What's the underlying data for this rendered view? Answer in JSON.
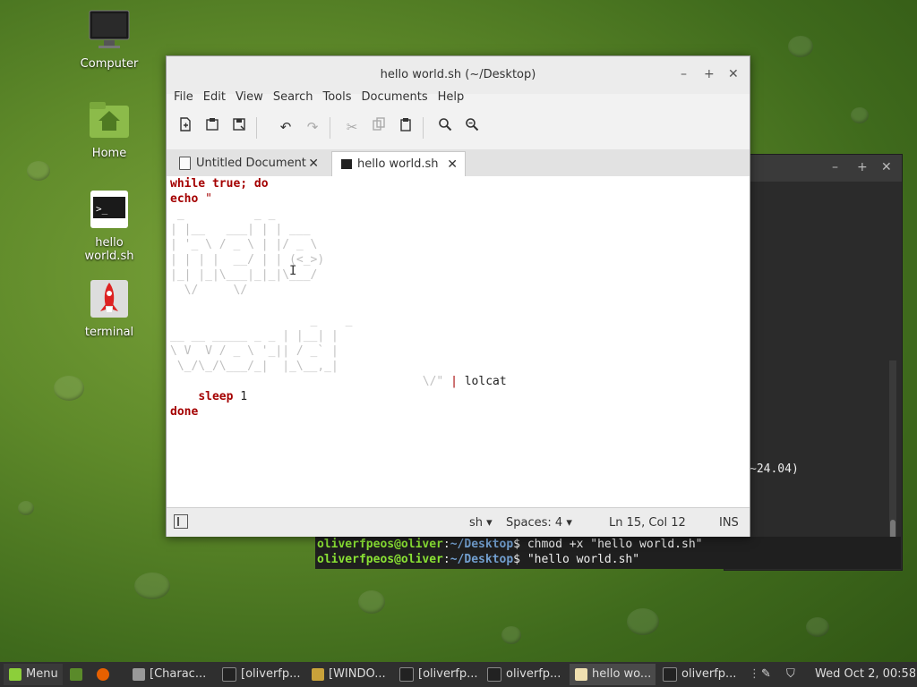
{
  "desktop": {
    "icons": [
      {
        "label": "Computer"
      },
      {
        "label": "Home"
      },
      {
        "label": "hello world.sh"
      },
      {
        "label": "terminal"
      }
    ]
  },
  "editor": {
    "title": "hello world.sh (~/Desktop)",
    "menu": [
      "File",
      "Edit",
      "View",
      "Search",
      "Tools",
      "Documents",
      "Help"
    ],
    "tabs": [
      {
        "label": "Untitled Document"
      },
      {
        "label": "hello world.sh"
      }
    ],
    "code": {
      "line1": "while true; do",
      "line2_kw": "echo",
      "line2_str": " \"",
      "art_hello": " _          _ _\n| |__   ___| | | ___\n| '_ \\ / _ \\ | |/ _ \\\n| | | |  __/ | | (<_>)\n|_| |_|\\___|_|_|\\___/\n  \\/     \\/",
      "art_world": "                    _    _\n__ __ _____ _ _ | |__| |\n\\ V  V / _ \\ '_|| / _` |\n \\_/\\_/\\___/_|  |_\\__,_|",
      "line_end_art": "\\/\"",
      "line_end_pipe": " | ",
      "line_end_cmd": "lolcat",
      "sleep_kw": "sleep",
      "sleep_val": " 1",
      "done": "done"
    },
    "status": {
      "lang": "sh",
      "spaces": "Spaces: 4",
      "position": "Ln 15, Col 12",
      "mode": "INS"
    }
  },
  "terminal": {
    "partial_text": "~24.04)",
    "lines": [
      {
        "user": "oliverfpeos@oliver",
        "path": "~/Desktop",
        "cmd": "$ chmod +x \"hello world.sh\""
      },
      {
        "user": "oliverfpeos@oliver",
        "path": "~/Desktop",
        "cmd": "$ \"hello world.sh\""
      }
    ],
    "colon": ":"
  },
  "taskbar": {
    "menu_label": "Menu",
    "tasks": [
      {
        "label": "[Charac..."
      },
      {
        "label": "[oliverfp..."
      },
      {
        "label": "[WINDO..."
      },
      {
        "label": "[oliverfp..."
      },
      {
        "label": "oliverfp..."
      },
      {
        "label": "hello wo..."
      },
      {
        "label": "oliverfp..."
      }
    ],
    "clock": "Wed Oct  2, 00:58"
  }
}
